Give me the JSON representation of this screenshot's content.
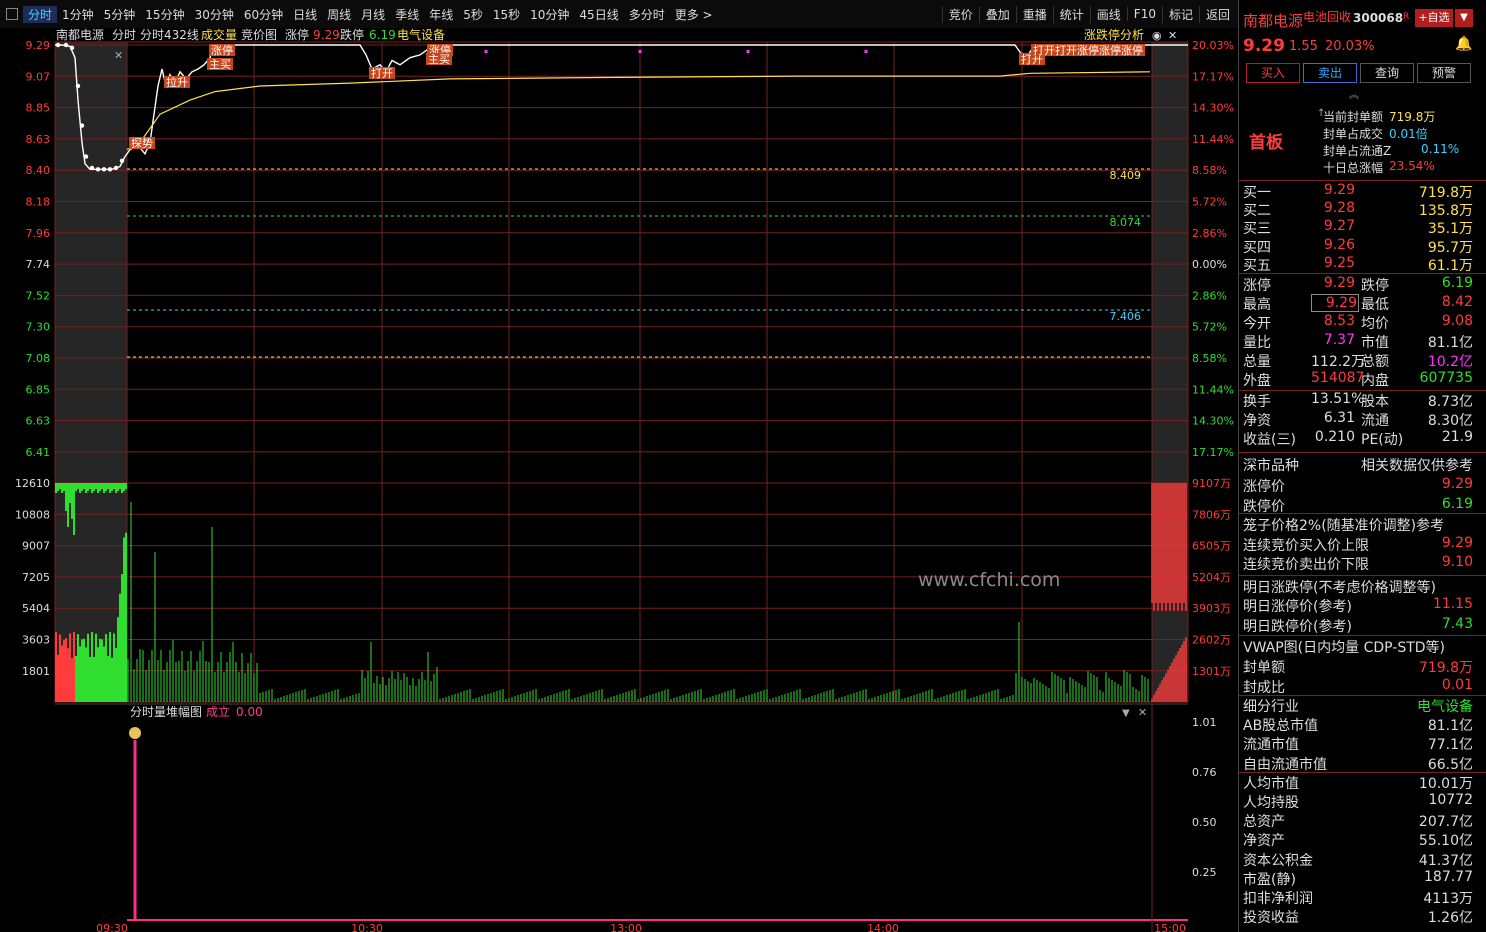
{
  "toolbar": {
    "tabs": [
      "分时",
      "1分钟",
      "5分钟",
      "15分钟",
      "30分钟",
      "60分钟",
      "日线",
      "周线",
      "月线",
      "季线",
      "年线",
      "5秒",
      "15秒",
      "10分钟",
      "45日线",
      "多分时",
      "更多 >"
    ],
    "right": [
      "竞价",
      "叠加",
      "重播",
      "统计",
      "画线",
      "F10",
      "标记",
      "返回"
    ]
  },
  "chart_header": {
    "name": "南都电源",
    "mode": "分时",
    "line": "分时432线",
    "vol": "成交量",
    "bid": "竞价图",
    "up_label": "涨停",
    "up_val": "9.29",
    "down_label": "跌停",
    "down_val": "6.19",
    "sector": "电气设备",
    "analysis": "涨跌停分析"
  },
  "price_axis": [
    "9.29",
    "9.07",
    "8.85",
    "8.63",
    "8.40",
    "8.18",
    "7.96",
    "7.74",
    "7.52",
    "7.30",
    "7.08",
    "6.85",
    "6.63",
    "6.41"
  ],
  "pct_axis": [
    "20.03%",
    "17.17%",
    "14.30%",
    "11.44%",
    "8.58%",
    "5.72%",
    "2.86%",
    "0.00%",
    "2.86%",
    "5.72%",
    "8.58%",
    "11.44%",
    "14.30%",
    "17.17%"
  ],
  "ref_lines": [
    "8.409",
    "8.074",
    "7.406"
  ],
  "vol_axis_left": [
    "12610",
    "10808",
    "9007",
    "7205",
    "5404",
    "3603",
    "1801"
  ],
  "vol_axis_right": [
    "9107万",
    "7806万",
    "6505万",
    "5204万",
    "3903万",
    "2602万",
    "1301万"
  ],
  "tags": [
    "拉升",
    "涨停",
    "主买",
    "打开",
    "涨停",
    "主买",
    "打开",
    "打开打开涨停涨停涨停"
  ],
  "tag_extra": "探势",
  "sub": {
    "title": "分时量堆幅图",
    "label": "成立",
    "val": "0.00",
    "axis": [
      "1.01",
      "0.76",
      "0.50",
      "0.25"
    ]
  },
  "watermark": "www.cfchi.com",
  "time_axis": [
    "09:30",
    "10:30",
    "13:00",
    "14:00",
    "15:00"
  ],
  "panel": {
    "name": "南都电源",
    "tag": "电池回收",
    "code": "300068",
    "r": "R",
    "add": "+自选",
    "price": "9.29",
    "chg": "1.55",
    "pct": "20.03%",
    "buttons": [
      "买入",
      "卖出",
      "查询",
      "预警"
    ],
    "board": "首板",
    "seal": [
      {
        "l": "当前封单额",
        "v": "719.8万"
      },
      {
        "l": "封单占成交",
        "v": "0.01倍"
      },
      {
        "l": "封单占流通Z",
        "v": "0.11%"
      },
      {
        "l": "十日总涨幅",
        "v": "23.54%"
      }
    ],
    "book": [
      {
        "l": "买一",
        "p": "9.29",
        "v": "719.8万"
      },
      {
        "l": "买二",
        "p": "9.28",
        "v": "135.8万"
      },
      {
        "l": "买三",
        "p": "9.27",
        "v": "35.1万"
      },
      {
        "l": "买四",
        "p": "9.26",
        "v": "95.7万"
      },
      {
        "l": "买五",
        "p": "9.25",
        "v": "61.1万"
      }
    ],
    "stats": [
      {
        "a": "涨停",
        "b": "9.29",
        "c": "跌停",
        "d": "6.19"
      },
      {
        "a": "最高",
        "b": "9.29",
        "c": "最低",
        "d": "8.42"
      },
      {
        "a": "今开",
        "b": "8.53",
        "c": "均价",
        "d": "9.08"
      },
      {
        "a": "量比",
        "b": "7.37",
        "c": "市值",
        "d": "81.1亿"
      },
      {
        "a": "总量",
        "b": "112.2万",
        "c": "总额",
        "d": "10.2亿"
      },
      {
        "a": "外盘",
        "b": "514087",
        "c": "内盘",
        "d": "607735"
      }
    ],
    "stats2": [
      {
        "a": "换手",
        "b": "13.51%",
        "c": "股本",
        "d": "8.73亿"
      },
      {
        "a": "净资",
        "b": "6.31",
        "c": "流通",
        "d": "8.30亿"
      },
      {
        "a": "收益(三)",
        "b": "0.210",
        "c": "PE(动)",
        "d": "21.9"
      }
    ],
    "market": {
      "l": "深市品种",
      "r": "相关数据仅供参考"
    },
    "limits": [
      {
        "l": "涨停价",
        "v": "9.29"
      },
      {
        "l": "跌停价",
        "v": "6.19"
      }
    ],
    "cage": "笼子价格2%(随基准价调整)参考",
    "cage_rows": [
      {
        "l": "连续竞价买入价上限",
        "v": "9.29"
      },
      {
        "l": "连续竞价卖出价下限",
        "v": "9.10"
      }
    ],
    "tomorrow_title": "明日涨跌停(不考虑价格调整等)",
    "tomorrow": [
      {
        "l": "明日涨停价(参考)",
        "v": "11.15"
      },
      {
        "l": "明日跌停价(参考)",
        "v": "7.43"
      }
    ],
    "vwap": "VWAP图(日内均量 CDP-STD等)",
    "seal2": [
      {
        "l": "封单额",
        "v": "719.8万"
      },
      {
        "l": "封成比",
        "v": "0.01"
      }
    ],
    "info": [
      {
        "l": "细分行业",
        "v": "电气设备"
      },
      {
        "l": "AB股总市值",
        "v": "81.1亿"
      },
      {
        "l": "流通市值",
        "v": "77.1亿"
      },
      {
        "l": "自由流通市值",
        "v": "66.5亿"
      },
      {
        "l": "人均市值",
        "v": "10.01万"
      },
      {
        "l": "人均持股",
        "v": "10772"
      },
      {
        "l": "总资产",
        "v": "207.7亿"
      },
      {
        "l": "净资产",
        "v": "55.10亿"
      },
      {
        "l": "资本公积金",
        "v": "41.37亿"
      },
      {
        "l": "市盈(静)",
        "v": "187.77"
      },
      {
        "l": "扣非净利润",
        "v": "4113万"
      },
      {
        "l": "投资收益",
        "v": "1.26亿"
      }
    ]
  },
  "colors": {
    "up": "#ff3b3b",
    "down": "#2fde2f",
    "avg": "#ffe14d",
    "grid": "#7a1f1f"
  }
}
